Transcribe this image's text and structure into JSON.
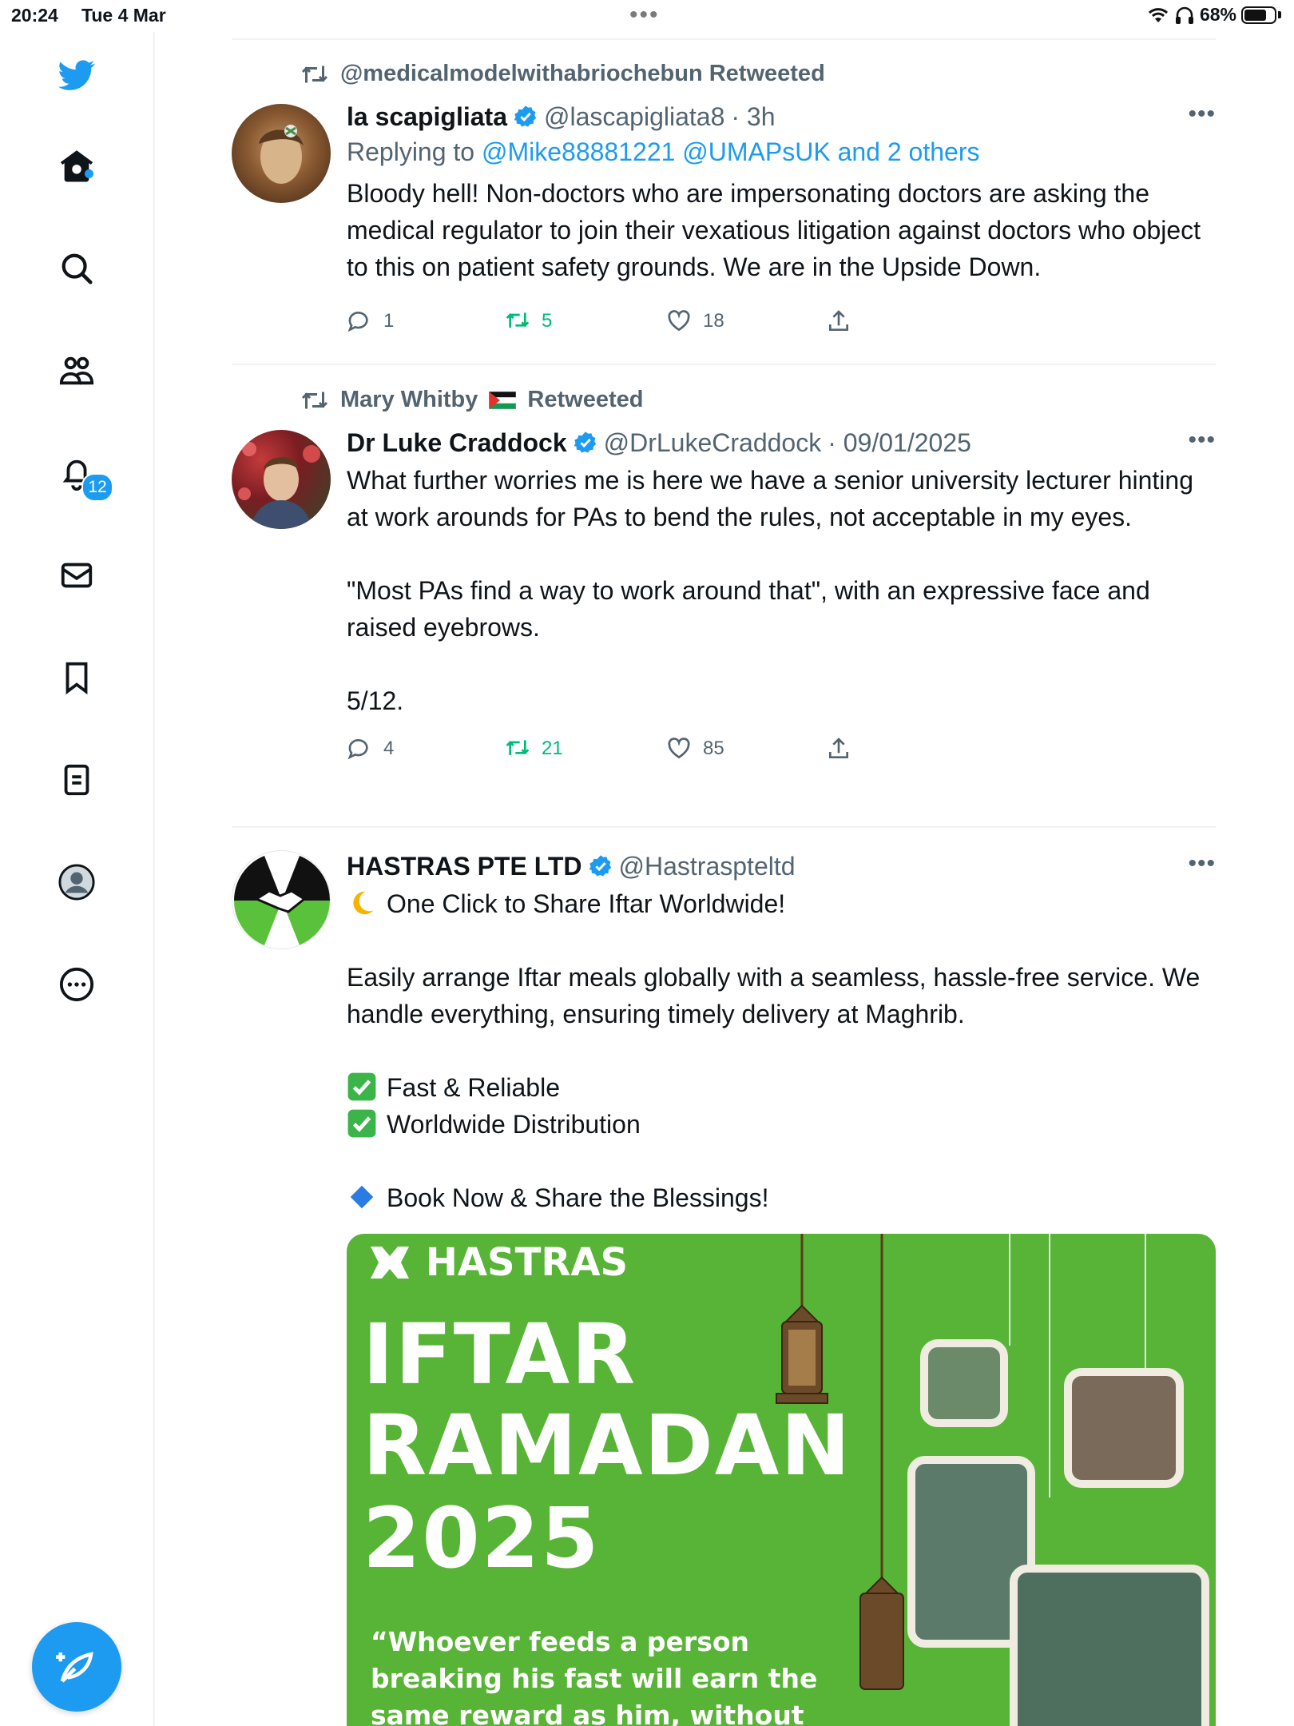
{
  "status_bar": {
    "time": "20:24",
    "date": "Tue 4 Mar",
    "battery": "68%"
  },
  "sidebar": {
    "notifications_badge": "12"
  },
  "tweets": [
    {
      "retweeted_by": "@medicalmodelwithabriochebun Retweeted",
      "name": "la scapigliata",
      "handle": "@lascapigliata8",
      "time": "· 3h",
      "replying_label": "Replying to",
      "replying_to": "@Mike88881221 @UMAPsUK and 2 others",
      "text": "Bloody hell! Non-doctors who are impersonating doctors are asking the medical regulator to join their vexatious litigation against doctors who object to this on patient safety grounds. We are in the Upside Down.",
      "replies": "1",
      "retweets": "5",
      "likes": "18"
    },
    {
      "retweeted_by_name": "Mary Whitby",
      "retweeted_by_suffix": "Retweeted",
      "name": "Dr Luke Craddock",
      "handle": "@DrLukeCraddock",
      "time": "· 09/01/2025",
      "text_p1": "What further worries me is here we have a senior university lecturer hinting at work arounds for PAs to bend the rules, not acceptable in my eyes.",
      "text_p2": "\"Most PAs find a way to work around that\", with an expressive face and raised eyebrows.",
      "text_p3": "5/12.",
      "replies": "4",
      "retweets": "21",
      "likes": "85"
    },
    {
      "name": "HASTRAS PTE LTD",
      "handle": "@Hastraspteltd",
      "line1": "One Click to Share Iftar Worldwide!",
      "line2": "Easily arrange Iftar meals globally with a seamless, hassle-free service. We handle everything, ensuring timely delivery at Maghrib.",
      "line3": "Fast & Reliable",
      "line4": "Worldwide Distribution",
      "line5": "Book Now & Share the Blessings!",
      "image": {
        "brand": "HASTRAS",
        "title1": "IFTAR",
        "title2": "RAMADAN",
        "title3": "2025",
        "quote": "“Whoever feeds a person breaking his fast will earn the same reward as him, without anything being"
      }
    }
  ]
}
